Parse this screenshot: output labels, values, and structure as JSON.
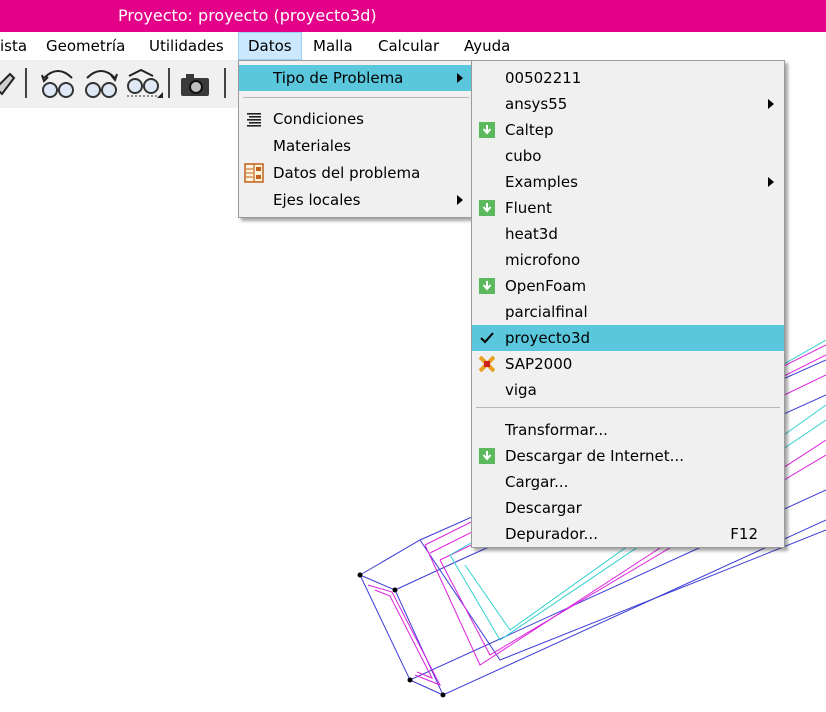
{
  "window": {
    "title": "Proyecto: proyecto (proyecto3d)",
    "accent": "#e5008a"
  },
  "menubar": {
    "items": [
      "ista",
      "Geometría",
      "Utilidades",
      "Datos",
      "Malla",
      "Calcular",
      "Ayuda"
    ],
    "active": "Datos"
  },
  "toolbar": {
    "icons": [
      "draw-icon",
      "zoom-glasses-icon",
      "rotate-glasses-icon",
      "grid-glasses-icon",
      "camera-icon"
    ]
  },
  "datos_menu": {
    "items": [
      {
        "label": "Tipo de Problema",
        "submenu": true,
        "highlighted": true,
        "icon": ""
      },
      {
        "label": "Condiciones",
        "submenu": false,
        "icon": "conditions-list-icon"
      },
      {
        "label": "Materiales",
        "submenu": false,
        "icon": ""
      },
      {
        "label": "Datos del problema",
        "submenu": false,
        "icon": "problem-data-icon"
      },
      {
        "label": "Ejes locales",
        "submenu": true,
        "icon": ""
      }
    ]
  },
  "tipo_submenu": {
    "problem_types": [
      {
        "label": "00502211",
        "icon": "",
        "submenu": false
      },
      {
        "label": "ansys55",
        "icon": "",
        "submenu": true
      },
      {
        "label": "Caltep",
        "icon": "download-green-icon",
        "submenu": false
      },
      {
        "label": "cubo",
        "icon": "",
        "submenu": false
      },
      {
        "label": "Examples",
        "icon": "",
        "submenu": true
      },
      {
        "label": "Fluent",
        "icon": "download-green-icon",
        "submenu": false
      },
      {
        "label": "heat3d",
        "icon": "",
        "submenu": false
      },
      {
        "label": "microfono",
        "icon": "",
        "submenu": false
      },
      {
        "label": "OpenFoam",
        "icon": "download-green-icon",
        "submenu": false
      },
      {
        "label": "parcialfinal",
        "icon": "",
        "submenu": false
      },
      {
        "label": "proyecto3d",
        "icon": "checkmark-icon",
        "submenu": false,
        "checked": true
      },
      {
        "label": "SAP2000",
        "icon": "sap-x-icon",
        "submenu": false
      },
      {
        "label": "viga",
        "icon": "",
        "submenu": false
      }
    ],
    "actions": [
      {
        "label": "Transformar...",
        "icon": "",
        "shortcut": ""
      },
      {
        "label": "Descargar de Internet...",
        "icon": "download-green-icon",
        "shortcut": ""
      },
      {
        "label": "Cargar...",
        "icon": "",
        "shortcut": ""
      },
      {
        "label": "Descargar",
        "icon": "",
        "shortcut": ""
      },
      {
        "label": "Depurador...",
        "icon": "",
        "shortcut": "F12"
      }
    ],
    "highlight_color": "#5bc7dd"
  },
  "geometry_colors": {
    "blue": "#3c3cd6",
    "magenta": "#dd22dd",
    "cyan": "#33d0d0"
  }
}
